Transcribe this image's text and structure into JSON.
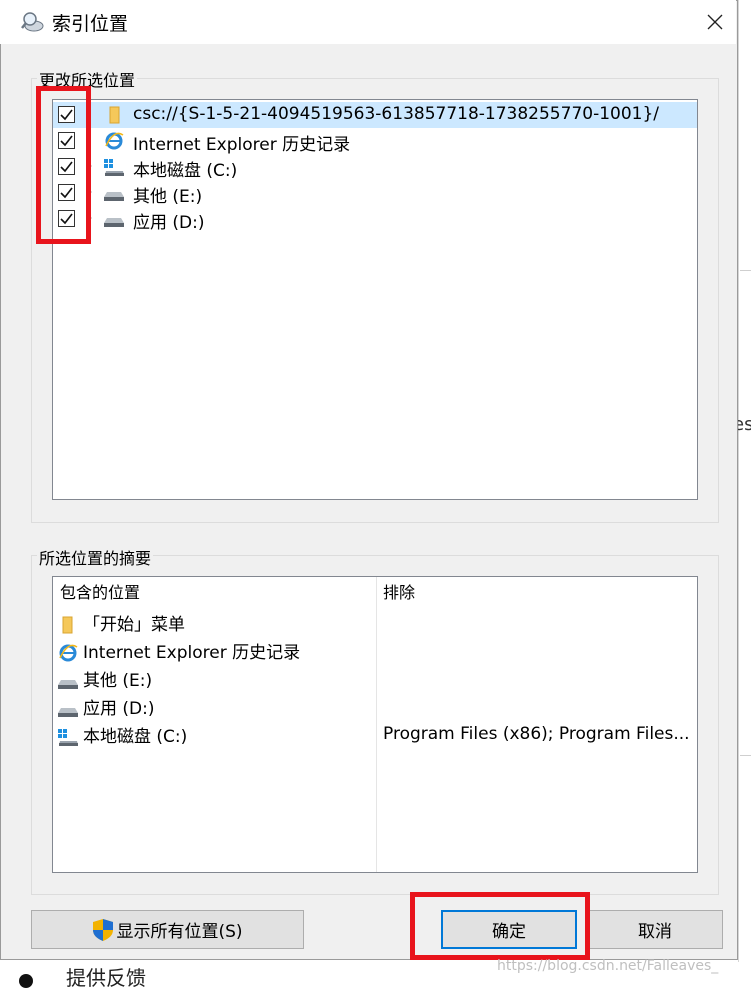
{
  "window": {
    "title": "索引位置"
  },
  "change_group": {
    "title": "更改所选位置",
    "items": [
      {
        "label": "csc://{S-1-5-21-4094519563-613857718-1738255770-1001}/",
        "checked": true,
        "icon": "folder-icon",
        "selected": true
      },
      {
        "label": "Internet Explorer 历史记录",
        "checked": true,
        "icon": "ie-icon"
      },
      {
        "label": "本地磁盘 (C:)",
        "checked": true,
        "icon": "windows-drive-icon"
      },
      {
        "label": "其他 (E:)",
        "checked": true,
        "icon": "drive-icon"
      },
      {
        "label": "应用 (D:)",
        "checked": true,
        "icon": "drive-icon"
      }
    ]
  },
  "summary_group": {
    "title": "所选位置的摘要",
    "columns": [
      "包含的位置",
      "排除"
    ],
    "rows": [
      {
        "location": "「开始」菜单",
        "icon": "folder-icon",
        "exclude": ""
      },
      {
        "location": "Internet Explorer 历史记录",
        "icon": "ie-icon",
        "exclude": ""
      },
      {
        "location": "其他 (E:)",
        "icon": "drive-icon",
        "exclude": ""
      },
      {
        "location": "应用 (D:)",
        "icon": "drive-icon",
        "exclude": ""
      },
      {
        "location": "本地磁盘 (C:)",
        "icon": "windows-drive-icon",
        "exclude": "Program Files (x86); Program Files..."
      }
    ]
  },
  "buttons": {
    "show_all": "显示所有位置(S)",
    "ok": "确定",
    "cancel": "取消"
  },
  "background": {
    "right_text": "es",
    "bottom_text": "提供反馈"
  },
  "watermark": "https://blog.csdn.net/Falleaves_",
  "colors": {
    "annotation": "#e8141c",
    "selection": "#cce8ff",
    "accent": "#0078d7"
  }
}
